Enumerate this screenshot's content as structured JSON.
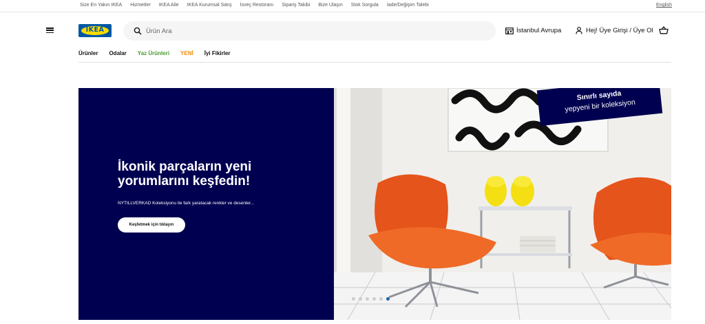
{
  "topbar": {
    "links": [
      "Size En Yakın IKEA",
      "Hizmetler",
      "IKEA Aile",
      "IKEA Kurumsal Satış",
      "İsveç Restoranı",
      "Sipariş Takibi",
      "Bize Ulaşın",
      "Stok Sorgula",
      "İade/Değişim Talebi"
    ],
    "language": "English"
  },
  "header": {
    "logo_text": "IKEA",
    "search_placeholder": "Ürün Ara",
    "store": "İstanbul Avrupa",
    "user": "Hej! Üye Girişi / Üye Ol"
  },
  "nav": {
    "items": [
      "Ürünler",
      "Odalar",
      "Yaz Ürünleri",
      "YENİ",
      "İyi Fikirler"
    ]
  },
  "hero": {
    "headline_line1": "İkonik parçaların yeni",
    "headline_line2": "yorumlarını keşfedin!",
    "subtext": "NYTILLVERKAD Koleksiyonu ile fark yaratacak renkler ve desenler...",
    "cta": "Keşfetmek için tıklayın",
    "badge_line1": "Sınırlı sayıda",
    "badge_line2": "yepyeni bir koleksiyon",
    "slide_count": 6,
    "active_slide": 6
  },
  "colors": {
    "brand_blue": "#0058a3",
    "brand_yellow": "#ffdb00",
    "hero_navy": "#000050",
    "chair_orange": "#ea5a1d",
    "nav_green": "#4a9b2f",
    "nav_orange": "#f28c0c"
  },
  "icons": [
    "menu-icon",
    "search-icon",
    "store-icon",
    "user-icon",
    "cart-icon"
  ]
}
